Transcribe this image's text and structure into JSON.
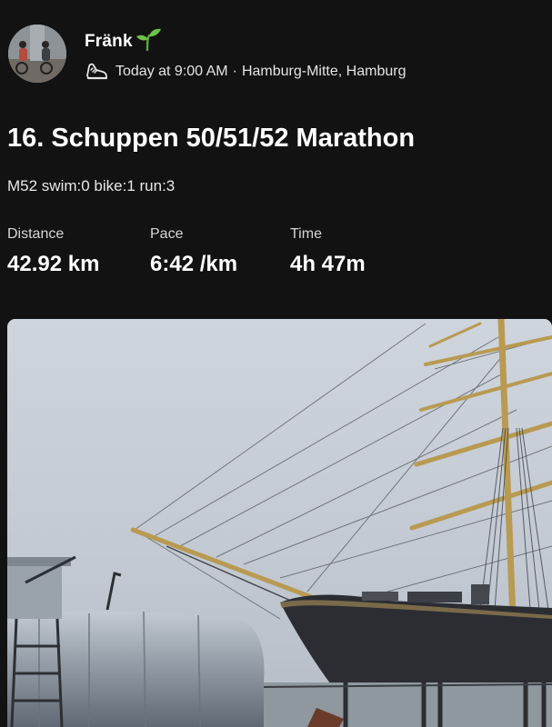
{
  "activity": {
    "athlete_name": "Fränk",
    "name_emoji_icon": "sprout-icon",
    "activity_type_icon": "running-shoe-icon",
    "timestamp": "Today at 9:00 AM",
    "separator": "·",
    "location": "Hamburg-Mitte, Hamburg",
    "title": "16. Schuppen 50/51/52 Marathon",
    "description": "M52 swim:0 bike:1 run:3"
  },
  "stats": {
    "distance": {
      "label": "Distance",
      "value": "42.92 km"
    },
    "pace": {
      "label": "Pace",
      "value": "6:42 /km"
    },
    "time": {
      "label": "Time",
      "value": "4h 47m"
    }
  },
  "colors": {
    "background": "#121212",
    "text_primary": "#ffffff",
    "text_secondary": "#e4e4e4",
    "sprout_green": "#6cc24a"
  }
}
